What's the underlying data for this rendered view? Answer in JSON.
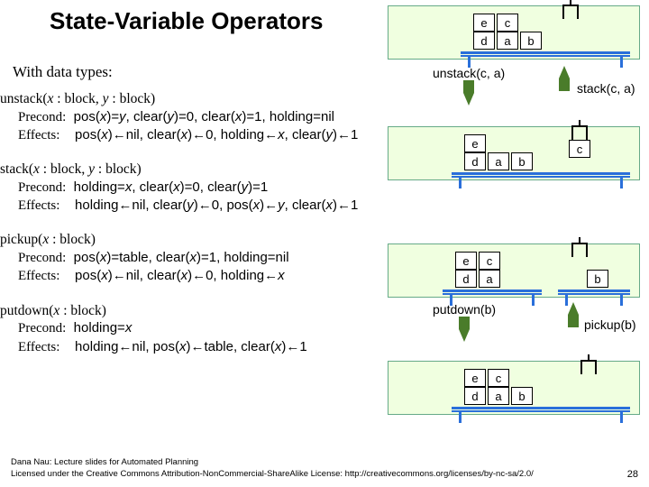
{
  "title": "State-Variable Operators",
  "subtitle": "With data types:",
  "ops": [
    {
      "name": "unstack",
      "sig_html": "unstack(<em>x</em> : block, <em>y</em> : block)",
      "precond": "pos(<em>x</em>)=<em>y</em>, clear(<em>y</em>)=0, clear(<em>x</em>)=1, holding=nil",
      "effects": "pos(<em>x</em>)←nil, clear(<em>x</em>)←0, holding←<em>x</em>, clear(<em>y</em>)←1"
    },
    {
      "name": "stack",
      "sig_html": "stack(<em>x</em> : block, <em>y</em> : block)",
      "precond": "holding=<em>x</em>, clear(<em>x</em>)=0, clear(<em>y</em>)=1",
      "effects": "holding←nil, clear(<em>y</em>)←0, pos(<em>x</em>)←<em>y</em>, clear(<em>x</em>)←1"
    },
    {
      "name": "pickup",
      "sig_html": "pickup(<em>x</em> : block)",
      "precond": "pos(<em>x</em>)=table, clear(<em>x</em>)=1, holding=nil",
      "effects": "pos(<em>x</em>)←nil, clear(<em>x</em>)←0, holding←<em>x</em>"
    },
    {
      "name": "putdown",
      "sig_html": "putdown(<em>x</em> : block)",
      "precond": "holding=<em>x</em>",
      "effects": "holding←nil, pos(<em>x</em>)←table, clear(<em>x</em>)←1"
    }
  ],
  "labels": {
    "precond": "Precond:",
    "effects": "Effects:"
  },
  "arrows": {
    "unstack": "unstack(c, a)",
    "stack": "stack(c, a)",
    "putdown": "putdown(b)",
    "pickup": "pickup(b)"
  },
  "blocks": {
    "a": "a",
    "b": "b",
    "c": "c",
    "d": "d",
    "e": "e"
  },
  "footer1": "Dana Nau: Lecture slides for Automated Planning",
  "footer2": "Licensed under the Creative Commons Attribution-NonCommercial-ShareAlike License: http://creativecommons.org/licenses/by-nc-sa/2.0/",
  "pagenum": "28"
}
